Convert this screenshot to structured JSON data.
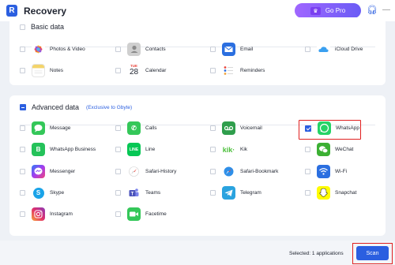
{
  "app": {
    "title": "Recovery",
    "go_pro": "Go Pro"
  },
  "basic": {
    "title": "Basic data",
    "items": [
      {
        "label": "Photos & Video",
        "icon": "photos-icon",
        "color": "#f2a33a"
      },
      {
        "label": "Contacts",
        "icon": "contacts-icon",
        "color": "#b9b9b9"
      },
      {
        "label": "Email",
        "icon": "email-icon",
        "color": "#2b6fe0"
      },
      {
        "label": "iCloud Drive",
        "icon": "icloud-icon",
        "color": "#3aa0f0"
      },
      {
        "label": "Notes",
        "icon": "notes-icon",
        "color": "#f3d46a"
      },
      {
        "label": "Calendar",
        "icon": "calendar-icon",
        "color": "#ffffff",
        "cal_day": "TUE",
        "cal_num": "28"
      },
      {
        "label": "Reminders",
        "icon": "reminders-icon",
        "color": "#ffffff"
      }
    ]
  },
  "advanced": {
    "title": "Advanced data",
    "exclusive": "(Exclusive to Gbyte)",
    "items": [
      {
        "label": "Message",
        "icon": "message-icon",
        "color": "#34c759"
      },
      {
        "label": "Calls",
        "icon": "calls-icon",
        "color": "#34c759"
      },
      {
        "label": "Voicemail",
        "icon": "voicemail-icon",
        "color": "#2f9e4c"
      },
      {
        "label": "WhatsApp",
        "icon": "whatsapp-icon",
        "color": "#25d366",
        "checked": true
      },
      {
        "label": "WhatsApp Business",
        "icon": "whatsapp-business-icon",
        "color": "#25c25a"
      },
      {
        "label": "Line",
        "icon": "line-icon",
        "color": "#06c755"
      },
      {
        "label": "Kik",
        "icon": "kik-icon",
        "color": "#ffffff"
      },
      {
        "label": "WeChat",
        "icon": "wechat-icon",
        "color": "#3cb034"
      },
      {
        "label": "Messenger",
        "icon": "messenger-icon",
        "color": "#8a4cf5"
      },
      {
        "label": "Safari-History",
        "icon": "safari-icon",
        "color": "#ffffff"
      },
      {
        "label": "Safari-Bookmark",
        "icon": "safari-bookmark-icon",
        "color": "#2f8fe8"
      },
      {
        "label": "Wi-Fi",
        "icon": "wifi-icon",
        "color": "#2b6fe0"
      },
      {
        "label": "Skype",
        "icon": "skype-icon",
        "color": "#1aa3e8"
      },
      {
        "label": "Teams",
        "icon": "teams-icon",
        "color": "#ffffff"
      },
      {
        "label": "Telegram",
        "icon": "telegram-icon",
        "color": "#2aa3df"
      },
      {
        "label": "Snapchat",
        "icon": "snapchat-icon",
        "color": "#fffc00"
      },
      {
        "label": "Instagram",
        "icon": "instagram-icon",
        "color": "#e1306c"
      },
      {
        "label": "Facetime",
        "icon": "facetime-icon",
        "color": "#34c759"
      }
    ]
  },
  "footer": {
    "selected": "Selected: 1 applications",
    "scan": "Scan"
  }
}
